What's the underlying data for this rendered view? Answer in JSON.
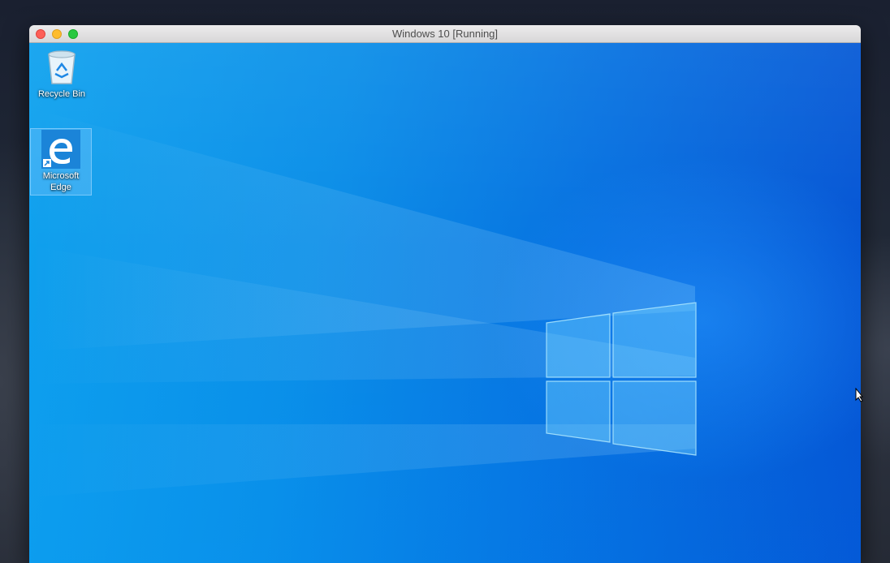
{
  "window": {
    "title": "Windows 10 [Running]"
  },
  "desktop": {
    "icons": [
      {
        "label": "Recycle Bin",
        "icon": "recycle-bin-icon"
      },
      {
        "label_line1": "Microsoft",
        "label_line2": "Edge",
        "icon": "microsoft-edge-icon",
        "selected": true
      }
    ]
  },
  "colors": {
    "wallpaper_light": "#0fa2ee",
    "wallpaper_dark": "#0550d2",
    "close": "#fd5f57",
    "minimize": "#febc2e",
    "maximize": "#28c840",
    "edge_tile": "#1b84d8"
  }
}
